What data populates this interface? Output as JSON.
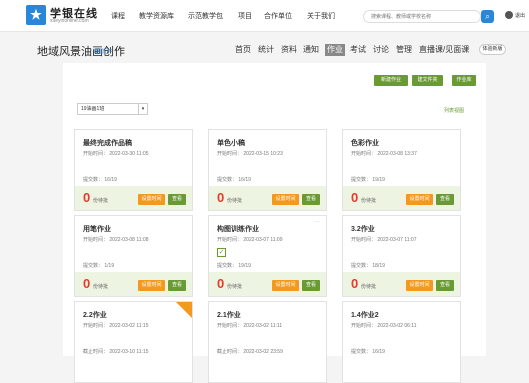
{
  "header": {
    "logo_glyph": "★",
    "logo_title": "学银在线",
    "logo_sub": "xueyinonline.com",
    "nav": [
      "课程",
      "教学资源库",
      "示范教学包",
      "项目",
      "合作单位",
      "关于我们"
    ],
    "search_placeholder": "搜索课程、教师或学校名称",
    "search_icon": "search-icon",
    "search_glyph": "⌕",
    "logout": "退出"
  },
  "course": {
    "title": "地域风景油画创作",
    "tag": "课程门户",
    "tabs": [
      "首页",
      "统计",
      "资料",
      "通知",
      "作业",
      "考试",
      "讨论",
      "管理",
      "直播课/见面课"
    ],
    "active_tab": "作业",
    "experience_btn": "体验新版"
  },
  "toolbar": {
    "new_homework": "新建作业",
    "new_folder": "建文件夹",
    "homework_bank": "作业库",
    "class_select": "19油画1班",
    "select_arrow": "▾",
    "list_view": "列表视图"
  },
  "card_labels": {
    "unreviewed": "份待批",
    "set_time": "设置时间",
    "view": "查看",
    "more": "···"
  },
  "cards": [
    {
      "title": "最终完成作品稿",
      "start": "开始时间： 2022-03-30 11:05",
      "submitted": "提交数： 16/19",
      "pending": "0"
    },
    {
      "title": "单色小稿",
      "start": "开始时间： 2022-03-15 10:23",
      "submitted": "提交数： 16/19",
      "pending": "0"
    },
    {
      "title": "色彩作业",
      "start": "开始时间： 2022-03-08 13:37",
      "submitted": "提交数： 19/19",
      "pending": "0"
    },
    {
      "title": "用笔作业",
      "start": "开始时间： 2022-03-08 11:08",
      "submitted": "提交数： 1/19",
      "pending": "0"
    },
    {
      "title": "构图训练作业",
      "start": "开始时间： 2022-03-07 11:09",
      "submitted": "提交数： 19/19",
      "pending": "0",
      "icon": "check-icon",
      "glyph": "✓",
      "more": true
    },
    {
      "title": "3.2作业",
      "start": "开始时间： 2022-03-07 11:07",
      "submitted": "提交数： 18/19",
      "pending": "0"
    },
    {
      "title": "2.2作业",
      "start": "开始时间： 2022-03-02 11:15",
      "submitted": "截止时间： 2022-03-10 11:15",
      "ribbon": true
    },
    {
      "title": "2.1作业",
      "start": "开始时间： 2022-03-02 11:11",
      "submitted": "截止时间： 2022-03-02 23:59"
    },
    {
      "title": "1.4作业2",
      "start": "开始时间： 2022-03-02 06:11",
      "submitted": "提交数： 16/19"
    }
  ]
}
